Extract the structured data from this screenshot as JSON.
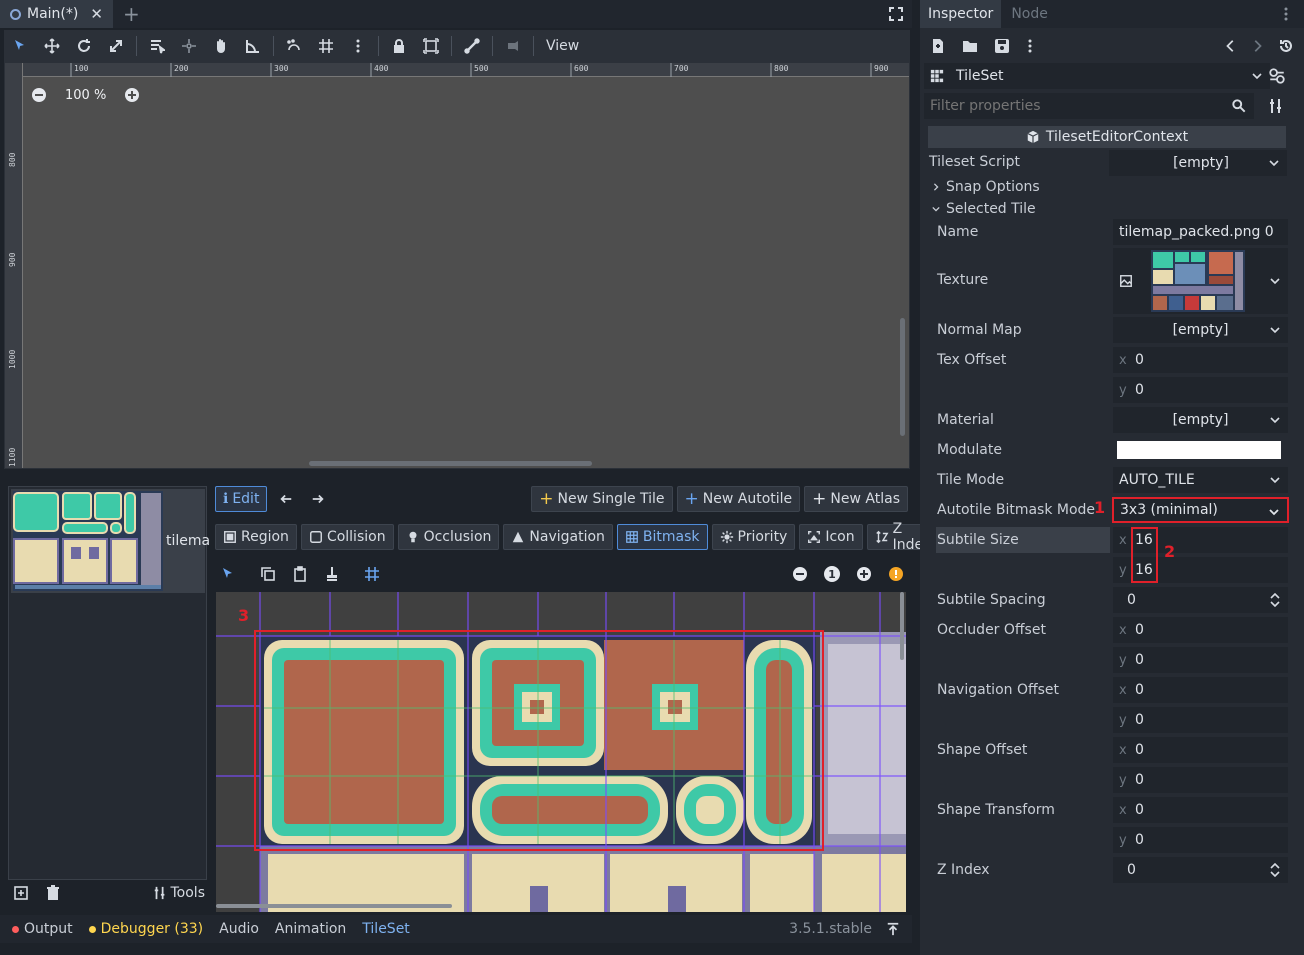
{
  "scene_tabs": {
    "active_tab": "Main(*)",
    "add_label": "+"
  },
  "viewport": {
    "view_menu": "View",
    "zoom": "100 %",
    "ruler_top": [
      "100",
      "200",
      "300",
      "400",
      "500",
      "600",
      "700",
      "800",
      "900"
    ],
    "ruler_left": [
      "800",
      "900",
      "1000",
      "1100"
    ]
  },
  "tileset_editor": {
    "tile_label": "tilema",
    "edit_button": "Edit",
    "new_single_tile": "New Single Tile",
    "new_autotile": "New Autotile",
    "new_atlas": "New Atlas",
    "modes": [
      {
        "label": "Region",
        "icon": "region-icon"
      },
      {
        "label": "Collision",
        "icon": "collision-icon"
      },
      {
        "label": "Occlusion",
        "icon": "occlusion-icon"
      },
      {
        "label": "Navigation",
        "icon": "navigation-icon"
      },
      {
        "label": "Bitmask",
        "icon": "bitmask-icon",
        "active": true
      },
      {
        "label": "Priority",
        "icon": "priority-icon"
      },
      {
        "label": "Icon",
        "icon": "icon-mode-icon"
      },
      {
        "label": "Z Index",
        "icon": "z-index-icon"
      }
    ],
    "zoom_reset": "1",
    "annotation_3": "3",
    "tools_label": "Tools"
  },
  "bottom_panel": {
    "output": "Output",
    "debugger": "Debugger (33)",
    "audio": "Audio",
    "animation": "Animation",
    "tileset": "TileSet",
    "version": "3.5.1.stable"
  },
  "inspector": {
    "tabs": [
      "Inspector",
      "Node"
    ],
    "resource": "TileSet",
    "filter_placeholder": "Filter properties",
    "context": "TilesetEditorContext",
    "tileset_script_label": "Tileset Script",
    "tileset_script_value": "[empty]",
    "snap_options": "Snap Options",
    "selected_tile": "Selected Tile",
    "properties": {
      "name_label": "Name",
      "name_value": "tilemap_packed.png 0",
      "texture_label": "Texture",
      "normal_map_label": "Normal Map",
      "normal_map_value": "[empty]",
      "tex_offset_label": "Tex Offset",
      "tex_offset_x": "0",
      "tex_offset_y": "0",
      "material_label": "Material",
      "material_value": "[empty]",
      "modulate_label": "Modulate",
      "tile_mode_label": "Tile Mode",
      "tile_mode_value": "AUTO_TILE",
      "bitmask_mode_label": "Autotile Bitmask Mode",
      "bitmask_mode_value": "3x3 (minimal)",
      "subtile_size_label": "Subtile Size",
      "subtile_size_x": "16",
      "subtile_size_y": "16",
      "subtile_spacing_label": "Subtile Spacing",
      "subtile_spacing_value": "0",
      "occluder_offset_label": "Occluder Offset",
      "occluder_offset_x": "0",
      "occluder_offset_y": "0",
      "navigation_offset_label": "Navigation Offset",
      "navigation_offset_x": "0",
      "navigation_offset_y": "0",
      "shape_offset_label": "Shape Offset",
      "shape_offset_x": "0",
      "shape_offset_y": "0",
      "shape_transform_label": "Shape Transform",
      "shape_transform_x": "0",
      "shape_transform_y": "0",
      "z_index_label": "Z Index",
      "z_index_value": "0"
    },
    "axis_x": "x",
    "axis_y": "y",
    "annotation_1": "1",
    "annotation_2": "2"
  },
  "colors": {
    "accent": "#4f8bd8",
    "annotation_red": "#e0202a",
    "tile_teal": "#3ec9a7",
    "tile_brown": "#b0664c",
    "tile_cream": "#e8dbb0"
  }
}
